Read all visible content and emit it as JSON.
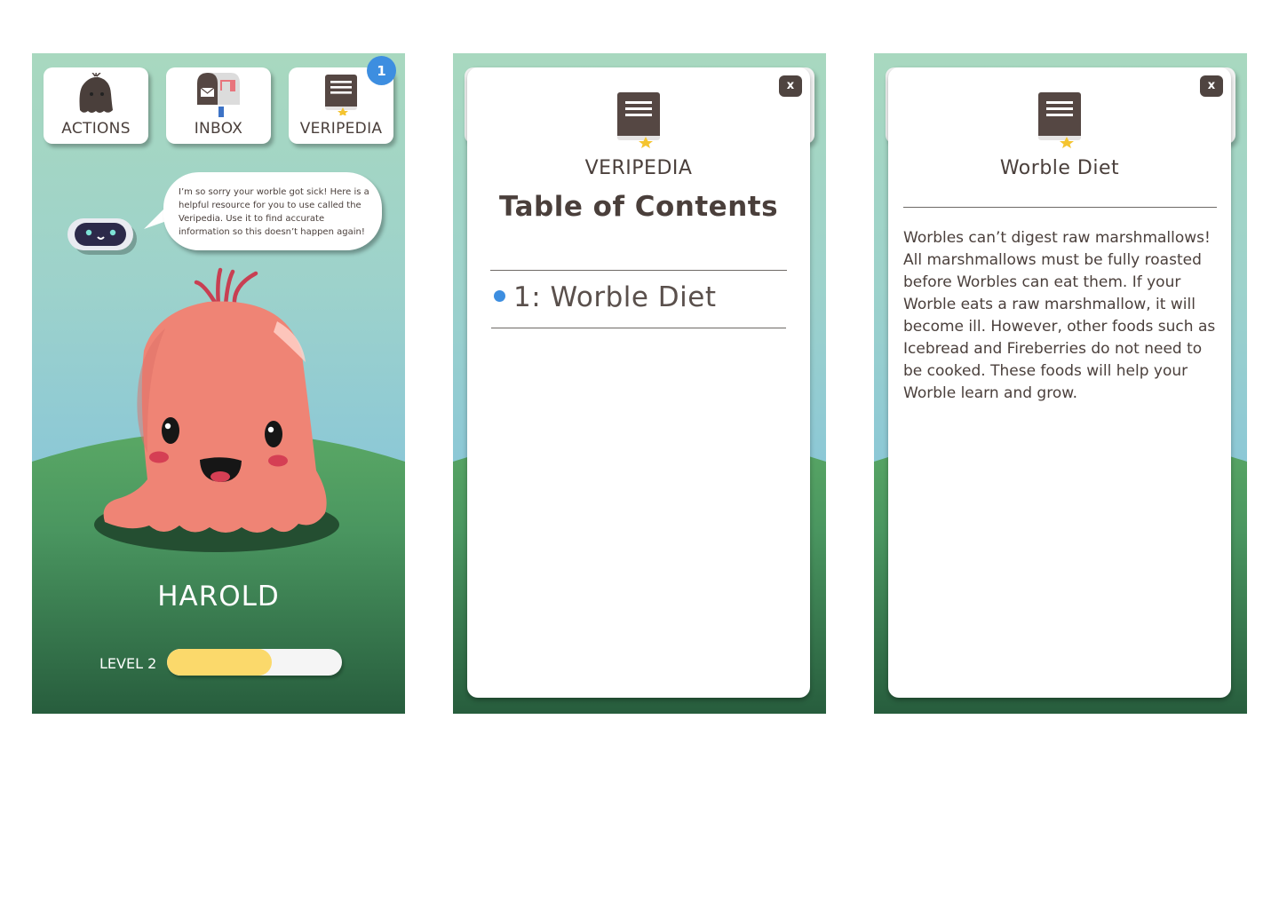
{
  "game_screen": {
    "tiles": [
      {
        "label": "ACTIONS",
        "icon": "worble-silhouette-icon"
      },
      {
        "label": "INBOX",
        "icon": "mailbox-icon"
      },
      {
        "label": "VERIPEDIA",
        "icon": "book-icon"
      }
    ],
    "notification_count": "1",
    "robot_message": "I’m so sorry your worble got sick! Here is a helpful resource for you to use called the Veripedia. Use it to find accurate information so this doesn’t happen again!",
    "pet_name": "HAROLD",
    "level_label": "LEVEL 2",
    "level_progress": 0.6
  },
  "toc_screen": {
    "close_label": "x",
    "subtitle": "VERIPEDIA",
    "title": "Table of Contents",
    "entries": [
      {
        "label": "1: Worble Diet"
      }
    ]
  },
  "article_screen": {
    "close_label": "x",
    "title": "Worble Diet",
    "body": "Worbles can’t digest raw marshmallows! All marshmallows must be fully roasted before Worbles can eat them. If your Worble eats a raw marshmallow, it will become ill. However, other foods such as Icebread and Fireberries do not need to be cooked. These foods will help your Worble learn and grow."
  },
  "colors": {
    "sky_top": "#a8d8bf",
    "sky_bottom": "#7ebfdc",
    "grass": "#5aa865",
    "grass_dark": "#275d3d",
    "worble_pink": "#ef8475",
    "badge_blue": "#3d8ee0",
    "progress_yellow": "#fbd96b",
    "book_brown": "#554743",
    "text_dark": "#4a3f3b"
  }
}
